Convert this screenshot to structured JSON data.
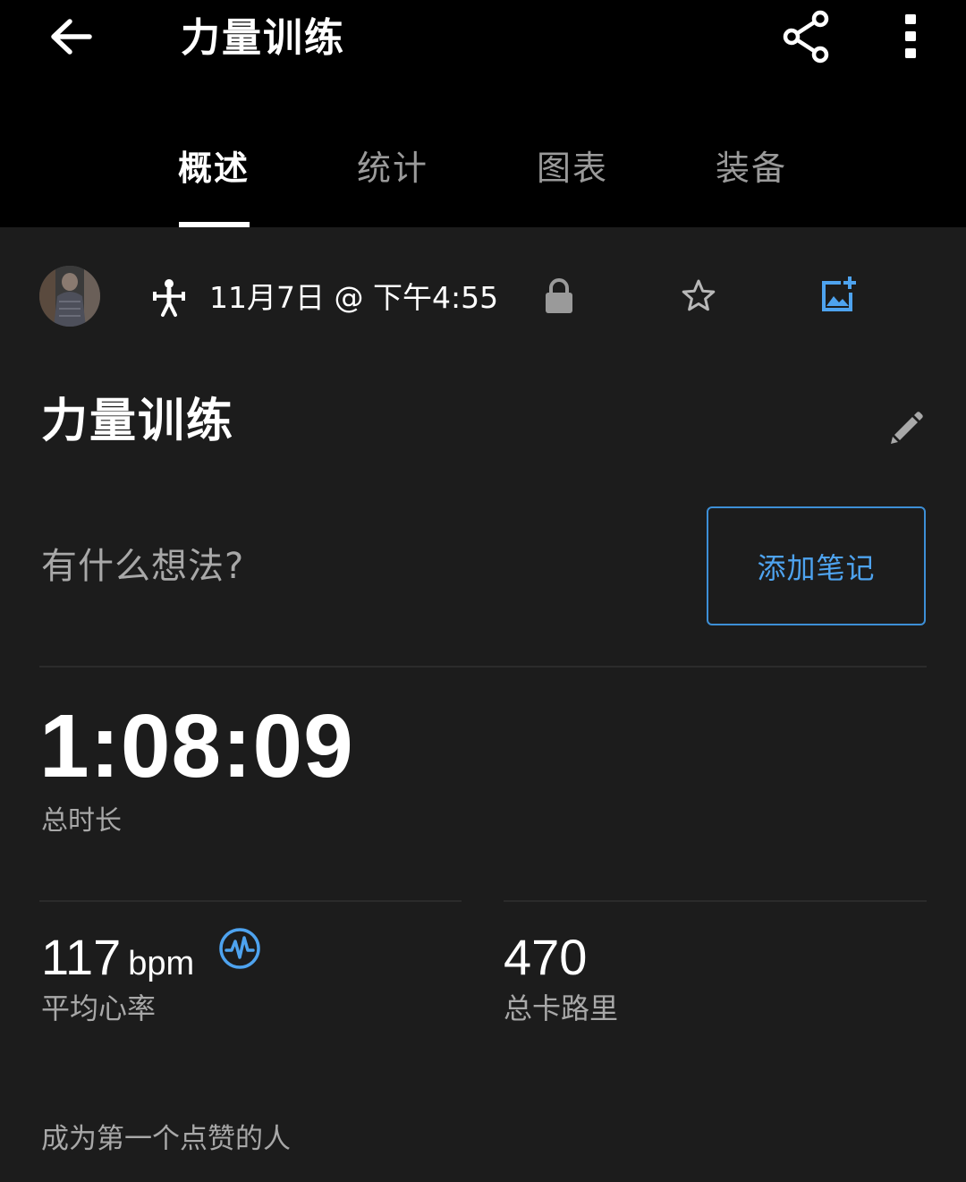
{
  "appbar": {
    "title": "力量训练",
    "back_icon": "arrow-left-icon",
    "share_icon": "share-icon",
    "more_icon": "more-vert-icon"
  },
  "tabs": [
    {
      "label": "概述",
      "active": true
    },
    {
      "label": "统计",
      "active": false
    },
    {
      "label": "图表",
      "active": false
    },
    {
      "label": "装备",
      "active": false
    }
  ],
  "activity": {
    "type_icon": "strength-training-icon",
    "datetime": "11月7日 @ 下午4:55",
    "privacy_icon": "lock-icon",
    "favorite_icon": "star-outline-icon",
    "add_photo_icon": "add-photo-icon",
    "title": "力量训练",
    "edit_icon": "pencil-icon"
  },
  "notes": {
    "prompt": "有什么想法?",
    "add_button": "添加笔记"
  },
  "duration": {
    "value": "1:08:09",
    "label": "总时长"
  },
  "stats": {
    "heart_rate": {
      "value": "117",
      "unit": "bpm",
      "label": "平均心率",
      "icon": "heart-rate-pulse-icon"
    },
    "calories": {
      "value": "470",
      "label": "总卡路里"
    }
  },
  "likes": {
    "text": "成为第一个点赞的人"
  },
  "colors": {
    "background": "#1c1c1c",
    "appbar": "#000000",
    "accent": "#4ea3ef",
    "muted_text": "#a8a8a8",
    "divider": "#2b2b2b"
  }
}
